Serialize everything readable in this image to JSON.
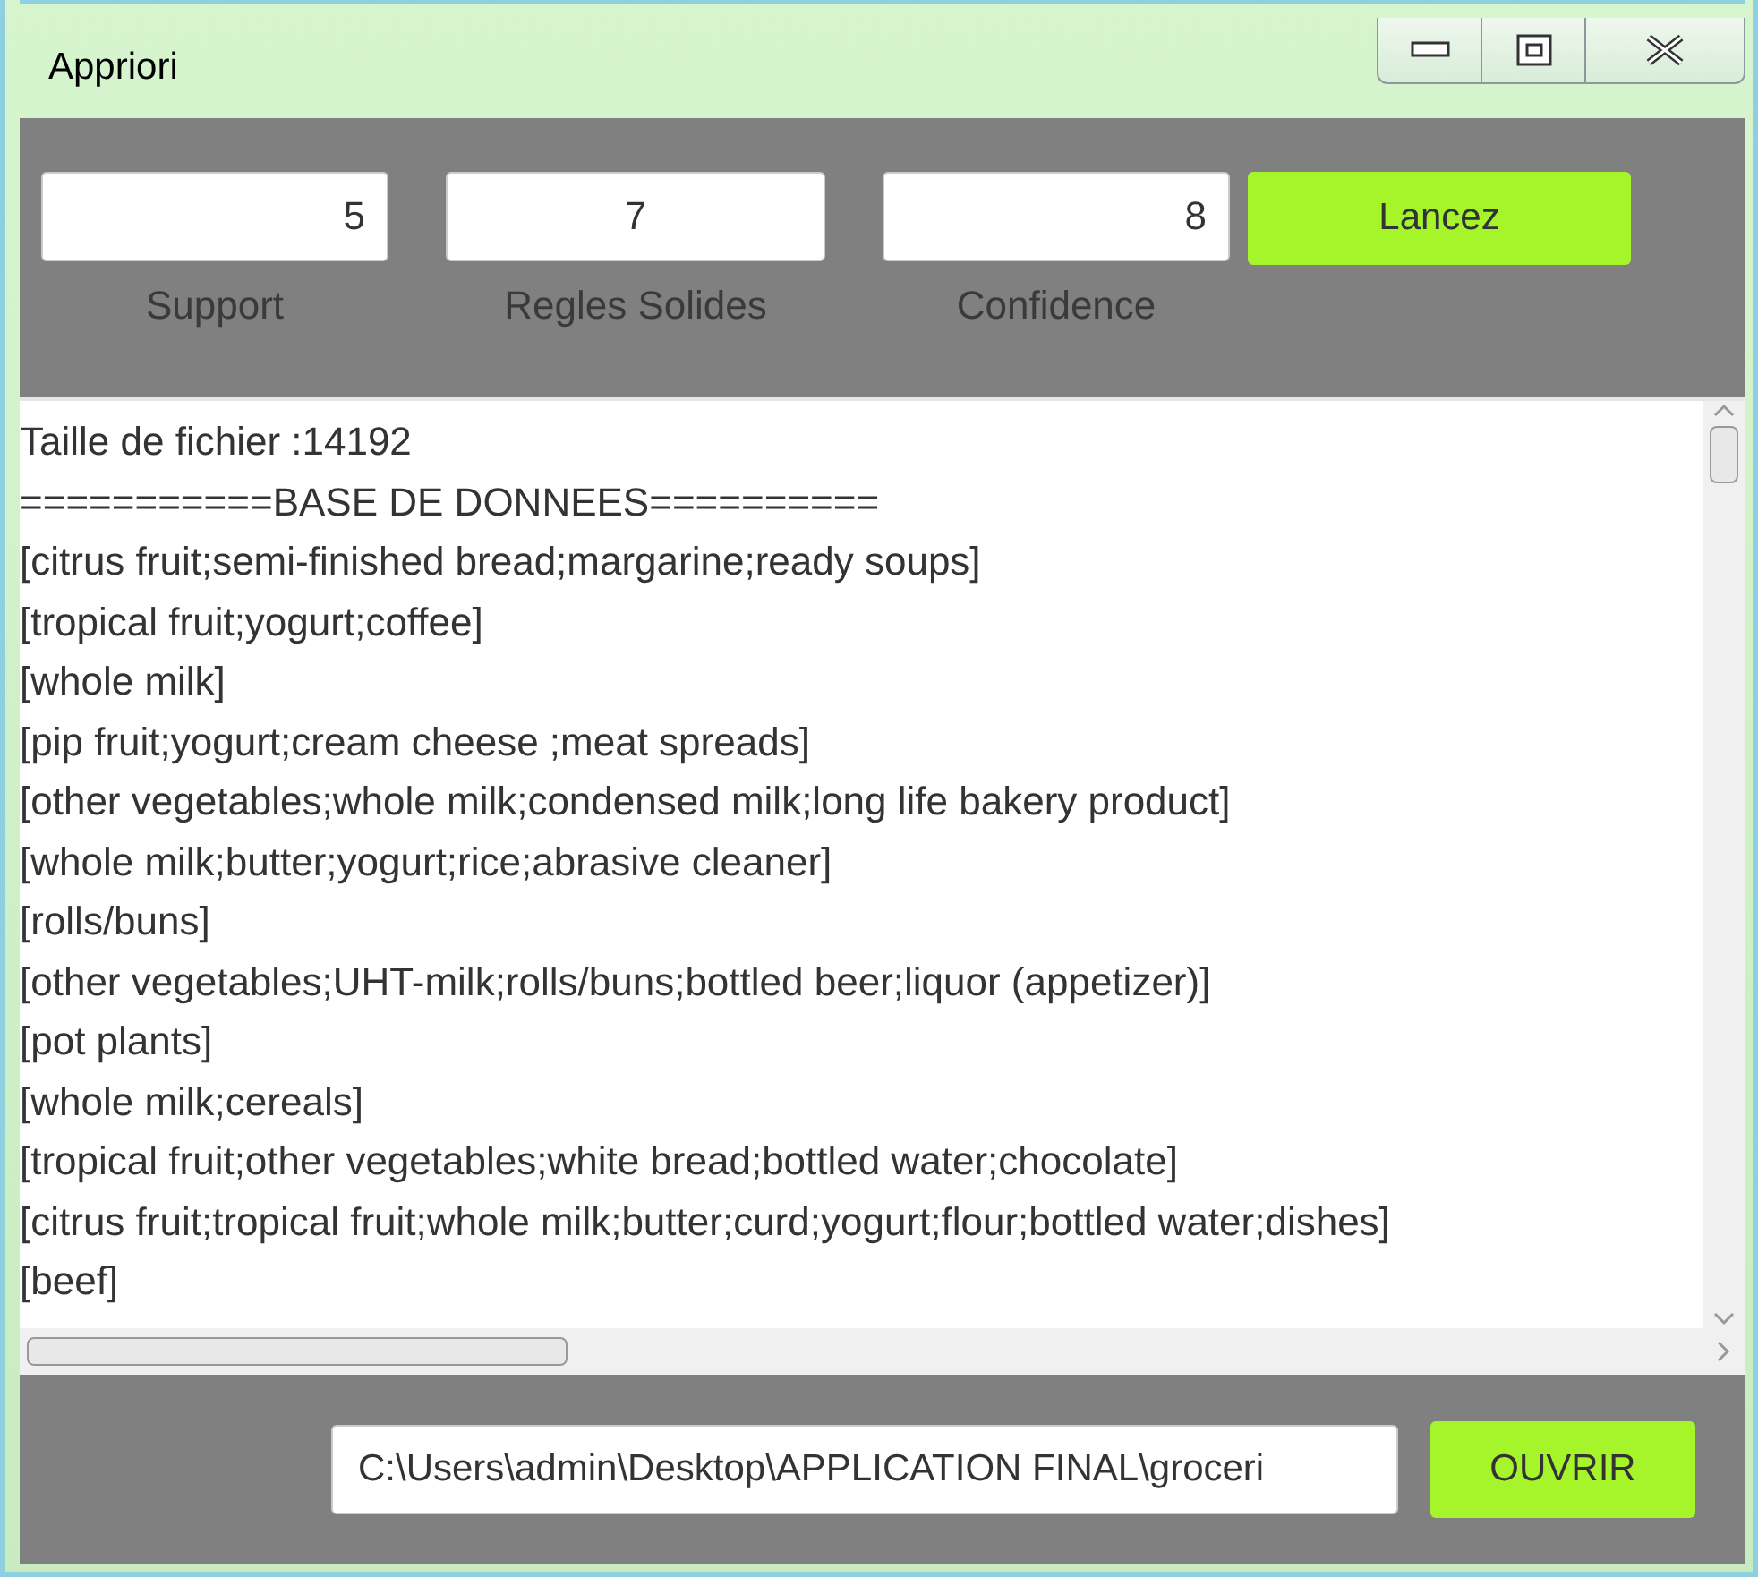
{
  "window": {
    "title": "Appriori"
  },
  "params": [
    {
      "value": "5",
      "label": "Support"
    },
    {
      "value": "7",
      "label": "Regles Solides"
    },
    {
      "value": "8",
      "label": "Confidence"
    }
  ],
  "run_button": "Lancez",
  "output_lines": [
    "Taille de fichier :14192",
    "===========BASE DE DONNEES==========",
    "[citrus fruit;semi-finished bread;margarine;ready soups]",
    "[tropical fruit;yogurt;coffee]",
    "[whole milk]",
    "[pip fruit;yogurt;cream cheese ;meat spreads]",
    "[other vegetables;whole milk;condensed milk;long life bakery product]",
    "[whole milk;butter;yogurt;rice;abrasive cleaner]",
    "[rolls/buns]",
    "[other vegetables;UHT-milk;rolls/buns;bottled beer;liquor (appetizer)]",
    "[pot plants]",
    "[whole milk;cereals]",
    "[tropical fruit;other vegetables;white bread;bottled water;chocolate]",
    "[citrus fruit;tropical fruit;whole milk;butter;curd;yogurt;flour;bottled water;dishes]",
    "[beef]"
  ],
  "file_path": "C:\\Users\\admin\\Desktop\\APPLICATION FINAL\\groceri",
  "open_button": "OUVRIR"
}
